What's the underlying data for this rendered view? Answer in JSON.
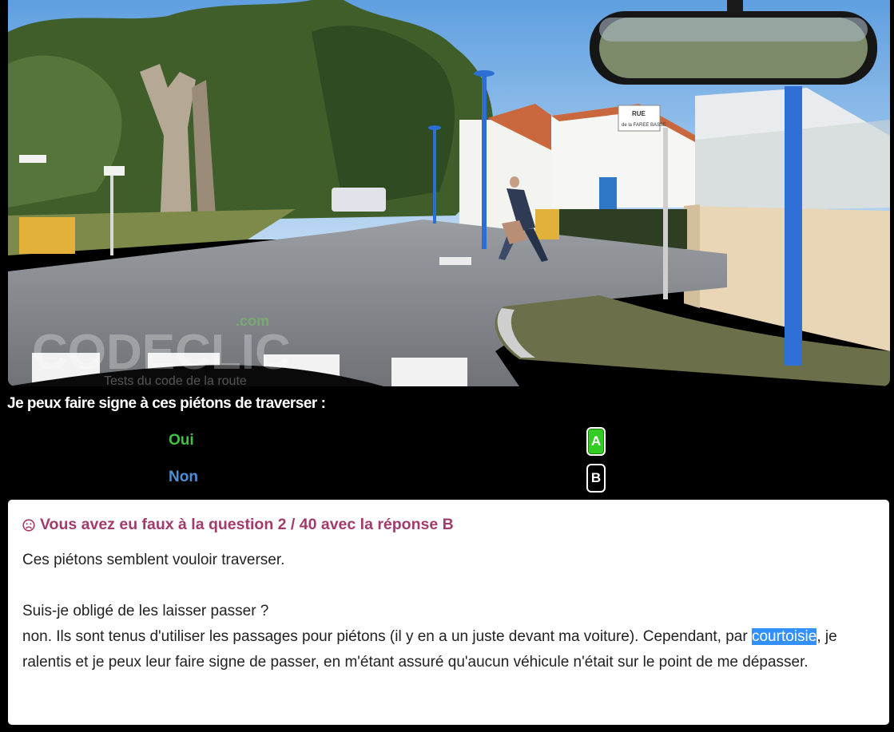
{
  "scene": {
    "watermark_brand": "CODECLIC",
    "watermark_domain": ".com",
    "watermark_tagline": "Tests du code de la route",
    "street_sign_line1": "RUE",
    "street_sign_line2": "de la FAREE BASSE"
  },
  "question": {
    "text": "Je peux faire signe à ces piétons de traverser :"
  },
  "answers": [
    {
      "label": "Oui",
      "key": "A",
      "state": "selected-correct",
      "color": "#3ec43e"
    },
    {
      "label": "Non",
      "key": "B",
      "state": "unselected",
      "color": "#4a90d9"
    }
  ],
  "feedback": {
    "icon": "frown-icon",
    "title": "Vous avez eu faux à la question 2 / 40 avec la réponse B",
    "line1": "Ces piétons semblent vouloir traverser.",
    "line2": "Suis-je obligé de les laisser passer ?",
    "line3_part1": "non. Ils sont tenus d'utiliser les passages pour piétons (il y en a un juste devant ma voiture). Cependant, par ",
    "line3_highlight": "courtoisie",
    "line3_part2": ", je ralentis et je peux leur faire signe de passer, en m'étant assuré qu'aucun véhicule n'était sur le point de me dépasser.",
    "title_color": "#a23b6c"
  }
}
